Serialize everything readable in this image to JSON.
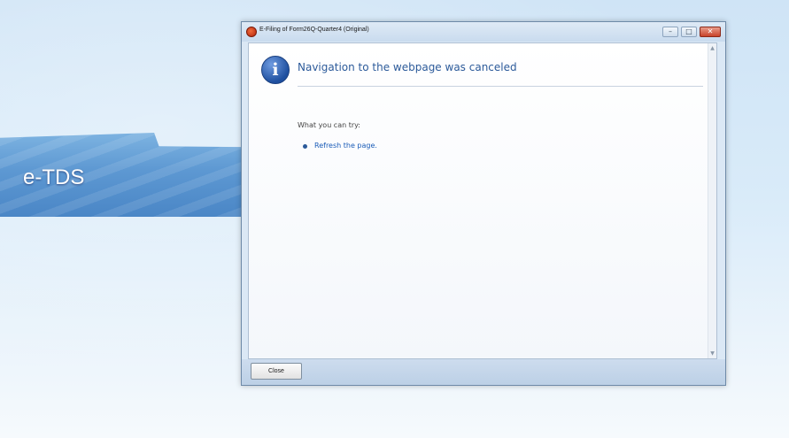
{
  "banner": {
    "label": "e-TDS"
  },
  "window": {
    "title": "E-Filing of Form26Q-Quarter4 (Original)",
    "controls": {
      "minimize": "–",
      "maximize": "□",
      "close": "✕"
    }
  },
  "message": {
    "heading": "Navigation to the webpage was canceled",
    "subheading": "What you can try:",
    "suggestions": [
      {
        "label": "Refresh the page."
      }
    ]
  },
  "footer": {
    "close_label": "Close"
  },
  "icons": {
    "info": "i",
    "app": "app-icon",
    "scroll_up": "▲",
    "scroll_down": "▼"
  },
  "colors": {
    "accent": "#2c5a9a",
    "link": "#1a5bb8",
    "banner": "#5d98d2"
  }
}
